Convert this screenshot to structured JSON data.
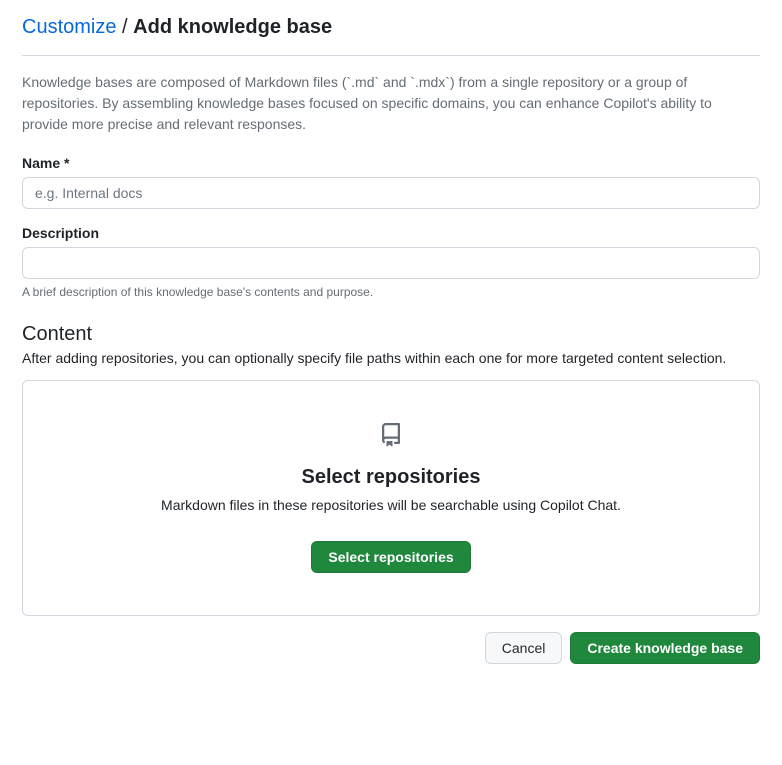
{
  "breadcrumb": {
    "parent": "Customize",
    "separator": "/",
    "current": "Add knowledge base"
  },
  "intro": "Knowledge bases are composed of Markdown files (`.md` and `.mdx`) from a single repository or a group of repositories. By assembling knowledge bases focused on specific domains, you can enhance Copilot's ability to provide more precise and relevant responses.",
  "nameField": {
    "label": "Name *",
    "placeholder": "e.g. Internal docs",
    "value": ""
  },
  "descriptionField": {
    "label": "Description",
    "value": "",
    "help": "A brief description of this knowledge base's contents and purpose."
  },
  "contentSection": {
    "heading": "Content",
    "sub": "After adding repositories, you can optionally specify file paths within each one for more targeted content selection.",
    "card": {
      "title": "Select repositories",
      "sub": "Markdown files in these repositories will be searchable using Copilot Chat.",
      "buttonLabel": "Select repositories"
    }
  },
  "footer": {
    "cancel": "Cancel",
    "submit": "Create knowledge base"
  }
}
